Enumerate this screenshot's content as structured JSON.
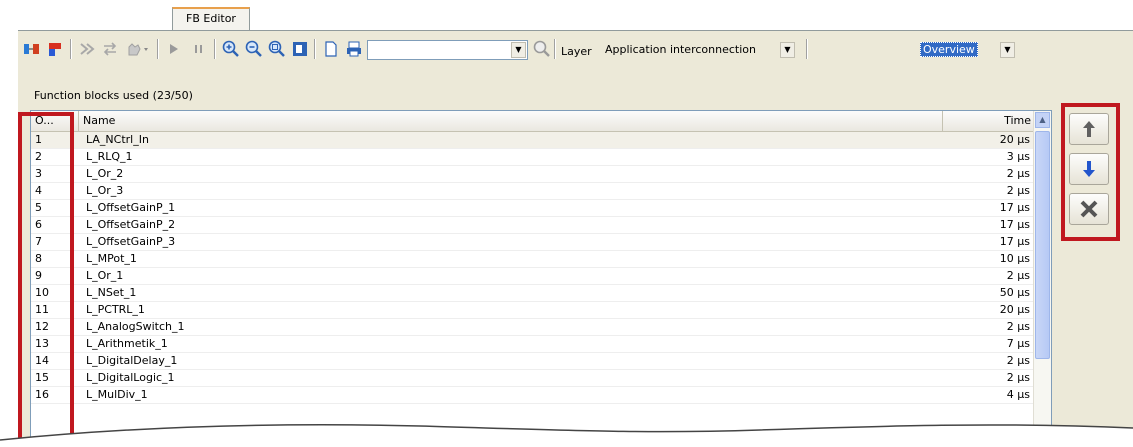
{
  "tab": {
    "label": "FB Editor"
  },
  "toolbar": {
    "search_value": "",
    "layer_label": "Layer",
    "layer_value": "Application interconnection",
    "view_value": "Overview"
  },
  "table": {
    "caption": "Function blocks used (23/50)",
    "columns": {
      "no": "O...",
      "name": "Name",
      "time": "Time"
    },
    "rows": [
      {
        "no": "1",
        "name": "LA_NCtrl_In",
        "time": "20 µs"
      },
      {
        "no": "2",
        "name": "L_RLQ_1",
        "time": "3 µs"
      },
      {
        "no": "3",
        "name": "L_Or_2",
        "time": "2 µs"
      },
      {
        "no": "4",
        "name": "L_Or_3",
        "time": "2 µs"
      },
      {
        "no": "5",
        "name": "L_OffsetGainP_1",
        "time": "17 µs"
      },
      {
        "no": "6",
        "name": "L_OffsetGainP_2",
        "time": "17 µs"
      },
      {
        "no": "7",
        "name": "L_OffsetGainP_3",
        "time": "17 µs"
      },
      {
        "no": "8",
        "name": "L_MPot_1",
        "time": "10 µs"
      },
      {
        "no": "9",
        "name": "L_Or_1",
        "time": "2 µs"
      },
      {
        "no": "10",
        "name": "L_NSet_1",
        "time": "50 µs"
      },
      {
        "no": "11",
        "name": "L_PCTRL_1",
        "time": "20 µs"
      },
      {
        "no": "12",
        "name": "L_AnalogSwitch_1",
        "time": "2 µs"
      },
      {
        "no": "13",
        "name": "L_Arithmetik_1",
        "time": "7 µs"
      },
      {
        "no": "14",
        "name": "L_DigitalDelay_1",
        "time": "2 µs"
      },
      {
        "no": "15",
        "name": "L_DigitalLogic_1",
        "time": "2 µs"
      },
      {
        "no": "16",
        "name": "L_MulDiv_1",
        "time": "4 µs"
      }
    ]
  },
  "side_buttons": {
    "up_icon": "arrow-up-icon",
    "down_icon": "arrow-down-icon",
    "remove_icon": "remove-x-icon"
  },
  "colors": {
    "highlight": "#c0181f",
    "accent_blue": "#2255cc"
  }
}
